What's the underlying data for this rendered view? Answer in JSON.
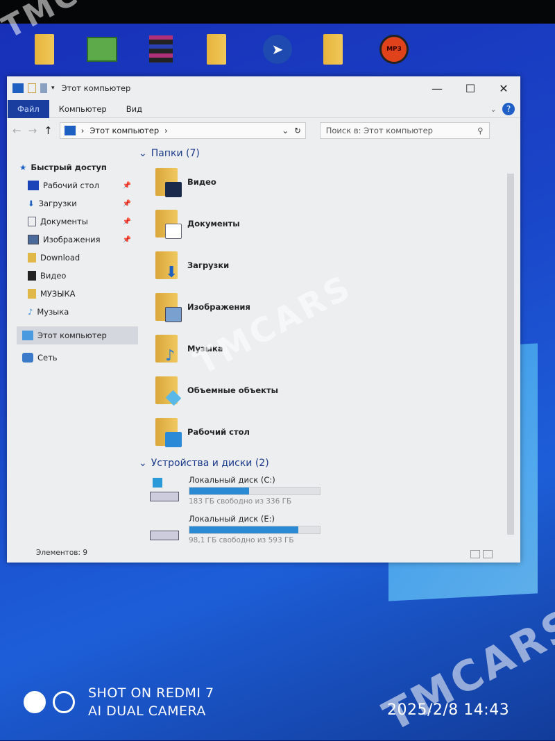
{
  "window": {
    "title": "Этот компьютер",
    "minimize": "—",
    "maximize": "☐",
    "close": "✕"
  },
  "ribbon": {
    "tabs": [
      "Файл",
      "Компьютер",
      "Вид"
    ],
    "help": "?"
  },
  "address": {
    "back": "←",
    "forward": "→",
    "up": "↑",
    "path": "Этот компьютер",
    "refresh": "↻",
    "search_placeholder": "Поиск в: Этот компьютер"
  },
  "sidebar": {
    "items": [
      {
        "label": "Быстрый доступ",
        "icon": "star-icon"
      },
      {
        "label": "Рабочий стол",
        "icon": "desktop-icon",
        "pinned": true
      },
      {
        "label": "Загрузки",
        "icon": "download-icon",
        "pinned": true
      },
      {
        "label": "Документы",
        "icon": "documents-icon",
        "pinned": true
      },
      {
        "label": "Изображения",
        "icon": "pictures-icon",
        "pinned": true
      },
      {
        "label": "Download",
        "icon": "folder-icon"
      },
      {
        "label": "Видео",
        "icon": "video-icon"
      },
      {
        "label": "МУЗЫКА",
        "icon": "folder-icon"
      },
      {
        "label": "Музыка",
        "icon": "music-icon"
      },
      {
        "label": "Этот компьютер",
        "icon": "computer-icon",
        "selected": true
      },
      {
        "label": "Сеть",
        "icon": "network-icon"
      }
    ]
  },
  "folders": {
    "header": "Папки (7)",
    "items": [
      "Видео",
      "Документы",
      "Загрузки",
      "Изображения",
      "Музыка",
      "Объемные объекты",
      "Рабочий стол"
    ]
  },
  "drives": {
    "header": "Устройства и диски (2)",
    "items": [
      {
        "name": "Локальный диск (C:)",
        "free": "183 ГБ свободно из 336 ГБ",
        "used_percent": 45.5
      },
      {
        "name": "Локальный диск (E:)",
        "free": "98,1 ГБ свободно из 593 ГБ",
        "used_percent": 83.5
      }
    ]
  },
  "status": {
    "items": "Элементов: 9"
  },
  "photo": {
    "line1": "SHOT ON REDMI 7",
    "line2": "AI DUAL CAMERA",
    "datetime": "2025/2/8  14:43",
    "watermark": "TMCARS"
  },
  "colors": {
    "accent": "#1a3ea0",
    "drive_bar": "#2a8ad4",
    "desktop": "#1a45c8"
  }
}
